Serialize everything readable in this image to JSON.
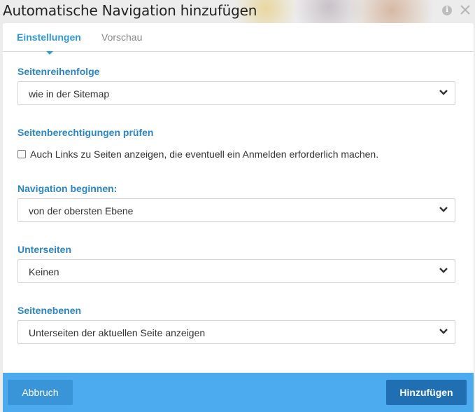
{
  "window": {
    "title": "Automatische Navigation hinzufügen",
    "info_icon": "info-icon",
    "close_icon": "close-icon",
    "info_glyph": "i"
  },
  "tabs": [
    {
      "label": "Einstellungen",
      "active": true
    },
    {
      "label": "Vorschau",
      "active": false
    }
  ],
  "sections": {
    "page_order": {
      "label": "Seitenreihenfolge",
      "selected": "wie in der Sitemap"
    },
    "permissions": {
      "label": "Seitenberechtigungen prüfen",
      "checkbox_label": "Auch Links zu Seiten anzeigen, die eventuell ein Anmelden erforderlich machen.",
      "checked": false
    },
    "start_navigation": {
      "label": "Navigation beginnen:",
      "selected": "von der obersten Ebene"
    },
    "subpages": {
      "label": "Unterseiten",
      "selected": "Keinen"
    },
    "page_levels": {
      "label": "Seitenebenen",
      "selected": "Unterseiten der aktuellen Seite anzeigen"
    }
  },
  "footer": {
    "cancel_label": "Abbruch",
    "add_label": "Hinzufügen"
  },
  "colors": {
    "accent": "#2f9ad9",
    "section_label": "#2a86c4",
    "footer_bg": "#4cabef",
    "cancel_bg": "#3994d8",
    "add_bg": "#1f6fb2"
  }
}
